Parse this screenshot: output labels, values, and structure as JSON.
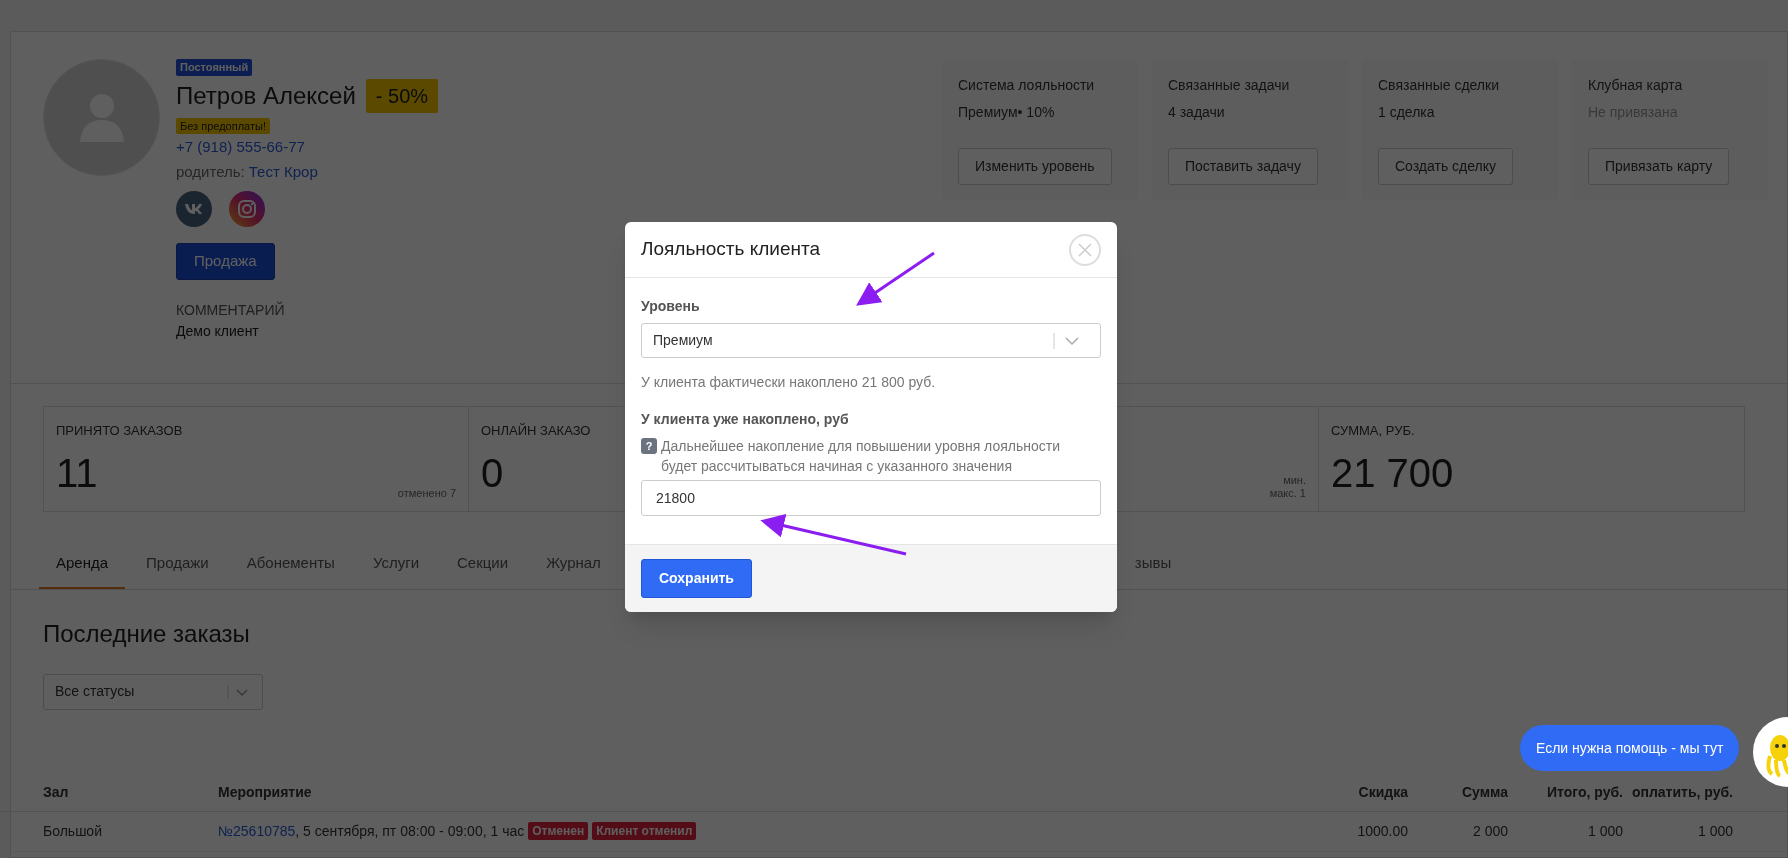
{
  "profile": {
    "status_badge": "Постоянный",
    "name": "Петров Алексей",
    "discount_badge": "- 50%",
    "prepay_badge": "Без предоплаты!",
    "phone": "+7 (918) 555-66-77",
    "parent_label": "родитель:",
    "parent_link": "Тест Крор",
    "sale_button": "Продажа",
    "comment_label": "КОММЕНТАРИЙ",
    "comment": "Демо клиент"
  },
  "info_cards": [
    {
      "title": "Система лояльности",
      "value": "Премиум• 10%",
      "muted": false,
      "button": "Изменить уровень"
    },
    {
      "title": "Связанные задачи",
      "value": "4 задачи",
      "muted": false,
      "button": "Поставить задачу"
    },
    {
      "title": "Связанные сделки",
      "value": "1 сделка",
      "muted": false,
      "button": "Создать сделку"
    },
    {
      "title": "Клубная карта",
      "value": "Не привязана",
      "muted": true,
      "button": "Привязать карту"
    }
  ],
  "stats": [
    {
      "label": "ПРИНЯТО ЗАКАЗОВ",
      "value": "11",
      "notes": [
        "отменено 7"
      ]
    },
    {
      "label": "ОНЛАЙН ЗАКАЗО",
      "value": "0"
    },
    {
      "notes": [
        "мин.",
        "макс. 1"
      ]
    },
    {
      "label": "СУММА, РУБ.",
      "value": "21 700"
    }
  ],
  "tabs": [
    {
      "label": "Аренда",
      "selected": true
    },
    {
      "label": "Продажи",
      "selected": false
    },
    {
      "label": "Абонементы",
      "selected": false
    },
    {
      "label": "Услуги",
      "selected": false
    },
    {
      "label": "Секции",
      "selected": false
    },
    {
      "label": "Журнал",
      "selected": false
    }
  ],
  "tabs_right": [
    {
      "label": "зывы",
      "selected": false
    }
  ],
  "orders": {
    "title": "Последние заказы",
    "filter": "Все статусы",
    "columns": [
      "Зал",
      "Мероприятие",
      "Скидка",
      "Сумма",
      "Итого, руб.",
      "оплатить, руб."
    ],
    "rows": [
      {
        "hall": "Большой",
        "event_link": "№25610785",
        "event_text": ", 5 сентября, пт 08:00 - 09:00, 1 час",
        "badges": [
          "Отменен",
          "Клиент отменил"
        ],
        "discount": "1000.00",
        "sum": "2 000",
        "total": "1 000",
        "due": "1 000"
      }
    ]
  },
  "modal": {
    "title": "Лояльность клиента",
    "level_label": "Уровень",
    "level_value": "Премиум",
    "actual_note": "У клиента фактически накоплено 21 800 руб.",
    "accumulated_label": "У клиента уже накоплено, руб",
    "help_mark": "?",
    "help_text": "Дальнейшее накопление для повышении уровня лояльности будет рассчитываться начиная с указанного значения",
    "accumulated_value": "21800",
    "save_button": "Сохранить"
  },
  "help_bubble": "Если нужна помощь - мы тут"
}
